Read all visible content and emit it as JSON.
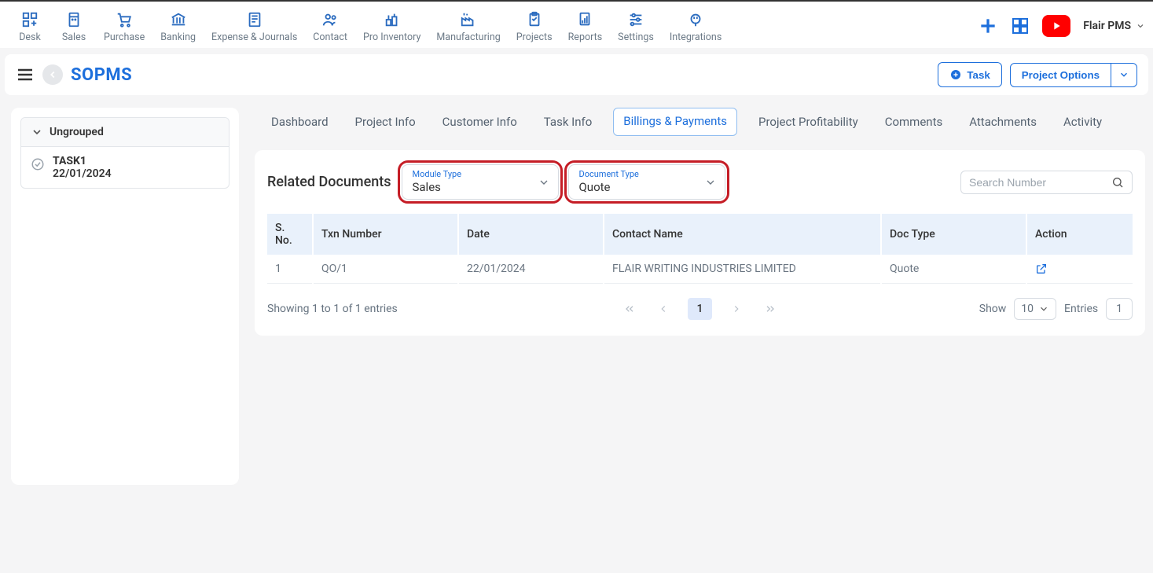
{
  "nav": {
    "items": [
      {
        "label": "Desk"
      },
      {
        "label": "Sales"
      },
      {
        "label": "Purchase"
      },
      {
        "label": "Banking"
      },
      {
        "label": "Expense & Journals"
      },
      {
        "label": "Contact"
      },
      {
        "label": "Pro Inventory"
      },
      {
        "label": "Manufacturing"
      },
      {
        "label": "Projects"
      },
      {
        "label": "Reports"
      },
      {
        "label": "Settings"
      },
      {
        "label": "Integrations"
      }
    ],
    "account_name": "Flair PMS"
  },
  "page": {
    "title": "SOPMS",
    "task_button": "Task",
    "options_button": "Project Options"
  },
  "sidebar": {
    "group_label": "Ungrouped",
    "items": [
      {
        "title": "TASK1",
        "date": "22/01/2024"
      }
    ]
  },
  "tabs": [
    "Dashboard",
    "Project Info",
    "Customer Info",
    "Task Info",
    "Billings & Payments",
    "Project Profitability",
    "Comments",
    "Attachments",
    "Activity"
  ],
  "active_tab_index": 4,
  "related": {
    "title": "Related Documents",
    "module_label": "Module Type",
    "module_value": "Sales",
    "doctype_label": "Document Type",
    "doctype_value": "Quote",
    "search_placeholder": "Search Number"
  },
  "table": {
    "headers": [
      "S. No.",
      "Txn Number",
      "Date",
      "Contact Name",
      "Doc Type",
      "Action"
    ],
    "rows": [
      {
        "sno": "1",
        "txn": "QO/1",
        "date": "22/01/2024",
        "contact": "FLAIR WRITING INDUSTRIES LIMITED",
        "doctype": "Quote"
      }
    ]
  },
  "pagination": {
    "showing_text": "Showing 1 to 1 of 1 entries",
    "current_page": "1",
    "show_label": "Show",
    "page_size": "10",
    "entries_label": "Entries",
    "total_count": "1"
  }
}
